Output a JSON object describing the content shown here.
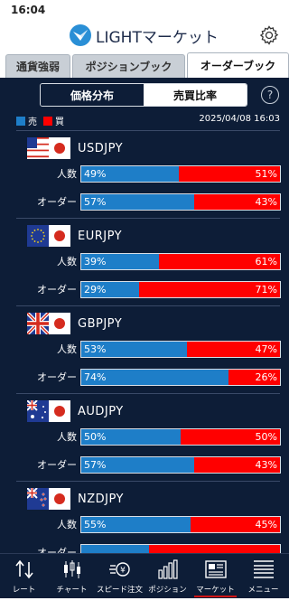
{
  "status": {
    "time": "16:04"
  },
  "header": {
    "title": "LIGHTマーケット"
  },
  "top_tabs": [
    {
      "label": "通貨強弱"
    },
    {
      "label": "ポジションブック"
    },
    {
      "label": "オーダーブック"
    }
  ],
  "segments": [
    {
      "label": "価格分布"
    },
    {
      "label": "売買比率"
    }
  ],
  "help": {
    "label": "?"
  },
  "legend": {
    "sell": "売",
    "buy": "買",
    "sell_color": "#1e7ec8",
    "buy_color": "#ff0000"
  },
  "timestamp": "2025/04/08 16:03",
  "row_labels": {
    "people": "人数",
    "order": "オーダー"
  },
  "pairs": [
    {
      "name": "USDJPY",
      "flag": "us-flag",
      "people": {
        "left": "49%",
        "right": "51%",
        "left_fraction": 0.49
      },
      "order": {
        "left": "57%",
        "right": "43%",
        "left_fraction": 0.57
      }
    },
    {
      "name": "EURJPY",
      "flag": "eu-flag",
      "people": {
        "left": "39%",
        "right": "61%",
        "left_fraction": 0.39
      },
      "order": {
        "left": "29%",
        "right": "71%",
        "left_fraction": 0.29
      }
    },
    {
      "name": "GBPJPY",
      "flag": "uk-flag",
      "people": {
        "left": "53%",
        "right": "47%",
        "left_fraction": 0.53
      },
      "order": {
        "left": "74%",
        "right": "26%",
        "left_fraction": 0.74
      }
    },
    {
      "name": "AUDJPY",
      "flag": "au-flag",
      "people": {
        "left": "50%",
        "right": "50%",
        "left_fraction": 0.5
      },
      "order": {
        "left": "57%",
        "right": "43%",
        "left_fraction": 0.57
      }
    },
    {
      "name": "NZDJPY",
      "flag": "nz-flag",
      "people": {
        "left": "55%",
        "right": "45%",
        "left_fraction": 0.55
      },
      "order": {
        "left": "",
        "right": "",
        "left_fraction": 0.34
      }
    }
  ],
  "bottom_nav": [
    {
      "label": "レート",
      "icon": "rate-arrows-icon"
    },
    {
      "label": "チャート",
      "icon": "candlestick-chart-icon"
    },
    {
      "label": "スピード注文",
      "icon": "speed-order-icon"
    },
    {
      "label": "ポジション",
      "icon": "position-bars-icon"
    },
    {
      "label": "マーケット",
      "icon": "newspaper-icon"
    },
    {
      "label": "メニュー",
      "icon": "menu-icon"
    }
  ]
}
